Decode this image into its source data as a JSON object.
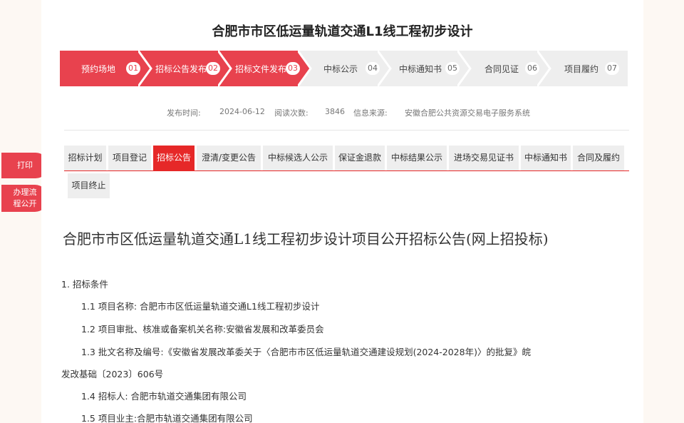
{
  "title": "合肥市市区低运量轨道交通L1线工程初步设计",
  "steps": [
    {
      "label": "预约场地",
      "num": "01",
      "active": true
    },
    {
      "label": "招标公告发布",
      "num": "02",
      "active": true
    },
    {
      "label": "招标文件发布",
      "num": "03",
      "active": true
    },
    {
      "label": "中标公示",
      "num": "04",
      "active": false
    },
    {
      "label": "中标通知书",
      "num": "05",
      "active": false
    },
    {
      "label": "合同见证",
      "num": "06",
      "active": false
    },
    {
      "label": "项目履约",
      "num": "07",
      "active": false
    }
  ],
  "meta": {
    "publish_label": "发布时间:",
    "publish_date": "2024-06-12",
    "views_label": "阅读次数:",
    "views": "3846",
    "source_label": "信息来源:",
    "source": "安徽合肥公共资源交易电子服务系统"
  },
  "tabs": [
    {
      "label": "招标计划"
    },
    {
      "label": "项目登记"
    },
    {
      "label": "招标公告",
      "active": true
    },
    {
      "label": "澄清/变更公告"
    },
    {
      "label": "中标候选人公示"
    },
    {
      "label": "保证金退款"
    },
    {
      "label": "中标结果公示"
    },
    {
      "label": "进场交易见证书"
    },
    {
      "label": "中标通知书"
    },
    {
      "label": "合同及履约"
    },
    {
      "label": "项目终止"
    }
  ],
  "side": {
    "print": "打印",
    "flow_line1": "办理流",
    "flow_line2": "程公开"
  },
  "doc": {
    "title": "合肥市市区低运量轨道交通L1线工程初步设计项目公开招标公告(网上招投标)",
    "section1": "1.  招标条件",
    "item_1_1": "1.1  项目名称:  合肥市市区低运量轨道交通L1线工程初步设计",
    "item_1_2": "1.2  项目审批、核准或备案机关名称:安徽省发展和改革委员会",
    "item_1_3a": "1.3  批文名称及编号:《安徽省发展改革委关于〈合肥市市区低运量轨道交通建设规划(2024-2028年)〉的批复》皖",
    "item_1_3b": "发改基础〔2023〕606号",
    "item_1_4": "1.4  招标人:  合肥市轨道交通集团有限公司",
    "item_1_5": "1.5  项目业主:合肥市轨道交通集团有限公司"
  },
  "colors": {
    "accent": "#e8424e",
    "tab_active": "#e62828",
    "step_inactive": "#eeeeee"
  }
}
